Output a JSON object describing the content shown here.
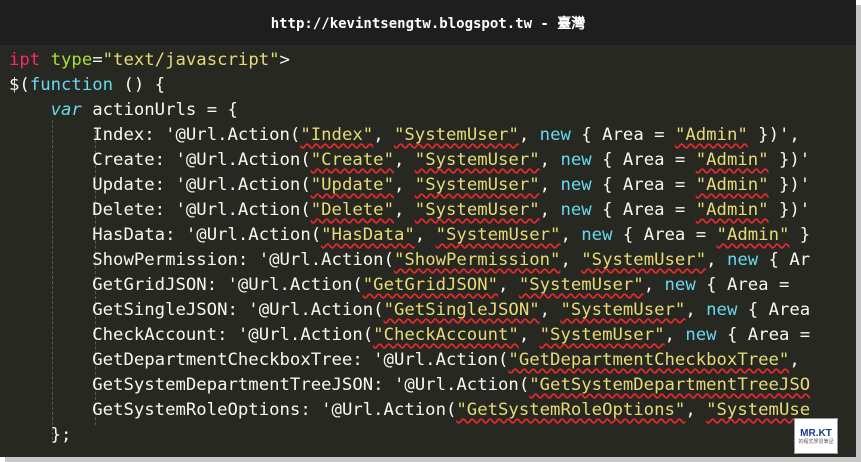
{
  "banner": {
    "text": "http://kevintsengtw.blogspot.tw - 臺灣"
  },
  "code": {
    "line1": {
      "kw": "ipt",
      "attr": "type",
      "eq": "=",
      "str": "\"text/javascript\"",
      "end": ">"
    },
    "line2": {
      "start": "$(",
      "kw": "function",
      "end": " () {"
    },
    "line3": {
      "kw": "var",
      "rest": " actionUrls = {"
    },
    "entries": [
      {
        "key": "Index",
        "pre": ": '@Url.Action(",
        "action": "\"Index\"",
        "c1": ", ",
        "ctrl": "\"SystemUser\"",
        "c2": ", ",
        "new": "new",
        "mid": " { Area = ",
        "area": "\"Admin\"",
        "tail": " })',"
      },
      {
        "key": "Create",
        "pre": ": '@Url.Action(",
        "action": "\"Create\"",
        "c1": ", ",
        "ctrl": "\"SystemUser\"",
        "c2": ", ",
        "new": "new",
        "mid": " { Area = ",
        "area": "\"Admin\"",
        "tail": " })'"
      },
      {
        "key": "Update",
        "pre": ": '@Url.Action(",
        "action": "\"Update\"",
        "c1": ", ",
        "ctrl": "\"SystemUser\"",
        "c2": ", ",
        "new": "new",
        "mid": " { Area = ",
        "area": "\"Admin\"",
        "tail": " })'"
      },
      {
        "key": "Delete",
        "pre": ": '@Url.Action(",
        "action": "\"Delete\"",
        "c1": ", ",
        "ctrl": "\"SystemUser\"",
        "c2": ", ",
        "new": "new",
        "mid": " { Area = ",
        "area": "\"Admin\"",
        "tail": " })'"
      },
      {
        "key": "HasData",
        "pre": ": '@Url.Action(",
        "action": "\"HasData\"",
        "c1": ", ",
        "ctrl": "\"SystemUser\"",
        "c2": ", ",
        "new": "new",
        "mid": " { Area = ",
        "area": "\"Admin\"",
        "tail": " }"
      },
      {
        "key": "ShowPermission",
        "pre": ": '@Url.Action(",
        "action": "\"ShowPermission\"",
        "c1": ", ",
        "ctrl": "\"SystemUser\"",
        "c2": ", ",
        "new": "new",
        "mid": " { Ar",
        "area": "",
        "tail": ""
      },
      {
        "key": "GetGridJSON",
        "pre": ": '@Url.Action(",
        "action": "\"GetGridJSON\"",
        "c1": ", ",
        "ctrl": "\"SystemUser\"",
        "c2": ", ",
        "new": "new",
        "mid": " { Area =",
        "area": "",
        "tail": ""
      },
      {
        "key": "GetSingleJSON",
        "pre": ": '@Url.Action(",
        "action": "\"GetSingleJSON\"",
        "c1": ", ",
        "ctrl": "\"SystemUser\"",
        "c2": ", ",
        "new": "new",
        "mid": " { Area",
        "area": "",
        "tail": ""
      },
      {
        "key": "CheckAccount",
        "pre": ": '@Url.Action(",
        "action": "\"CheckAccount\"",
        "c1": ", ",
        "ctrl": "\"SystemUser\"",
        "c2": ", ",
        "new": "new",
        "mid": " { Area =",
        "area": "",
        "tail": ""
      },
      {
        "key": "GetDepartmentCheckboxTree",
        "pre": ": '@Url.Action(",
        "action": "\"GetDepartmentCheckboxTree\"",
        "c1": ", ",
        "ctrl": "",
        "c2": "",
        "new": "",
        "mid": "",
        "area": "",
        "tail": ""
      },
      {
        "key": "GetSystemDepartmentTreeJSON",
        "pre": ": '@Url.Action(",
        "action": "\"GetSystemDepartmentTreeJSO",
        "c1": "",
        "ctrl": "",
        "c2": "",
        "new": "",
        "mid": "",
        "area": "",
        "tail": ""
      },
      {
        "key": "GetSystemRoleOptions",
        "pre": ": '@Url.Action(",
        "action": "\"GetSystemRoleOptions\"",
        "c1": ", ",
        "ctrl": "\"SystemUse",
        "c2": "",
        "new": "",
        "mid": "",
        "area": "",
        "tail": ""
      }
    ],
    "close": "};"
  },
  "badge": {
    "title": "MR.KT",
    "sub": "的程式學習筆記"
  },
  "colors": {
    "background": "#272822",
    "keyword": "#f92672",
    "attribute": "#a6e22e",
    "string": "#e6db74",
    "storage": "#66d9ef",
    "plain": "#f8f8f2",
    "squiggle": "#e8292c"
  }
}
